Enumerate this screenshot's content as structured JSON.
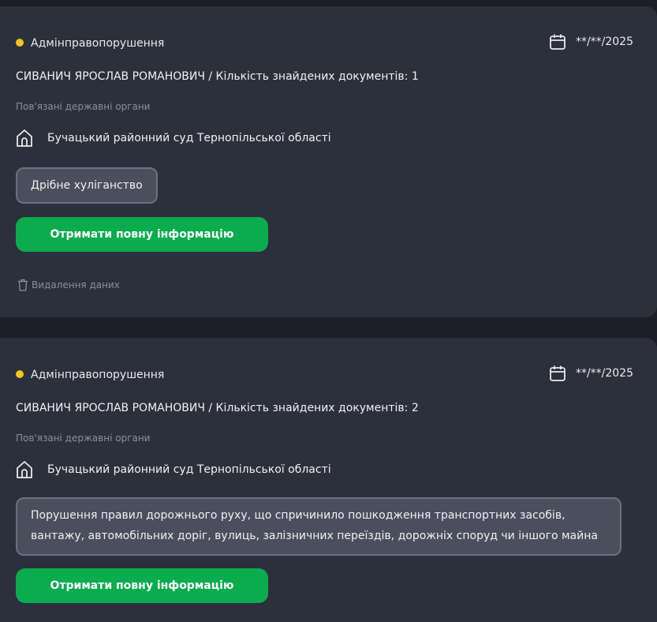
{
  "cards": [
    {
      "category": "Адмінправопорушення",
      "date": "**/**/2025",
      "title": "СИВАНИЧ ЯРОСЛАВ РОМАНОВИЧ / Кількість знайдених документів: 1",
      "related_label": "Пов'язані державні органи",
      "court": "Бучацький районний суд Тернопільської області",
      "tag": "Дрібне хуліганство",
      "button": "Отримати повну інформацію",
      "delete": "Видалення даних"
    },
    {
      "category": "Адмінправопорушення",
      "date": "**/**/2025",
      "title": "СИВАНИЧ ЯРОСЛАВ РОМАНОВИЧ / Кількість знайдених документів: 2",
      "related_label": "Пов'язані державні органи",
      "court": "Бучацький районний суд Тернопільської області",
      "tag": "Порушення правил дорожнього руху, що спричинило пошкодження транспортних засобів, вантажу, автомобільних доріг, вулиць, залізничних переїздів, дорожніх споруд чи іншого майна",
      "button": "Отримати повну інформацію"
    }
  ],
  "icons": {
    "status_dot": "status-dot",
    "date": "calendar-icon",
    "court": "building-icon",
    "delete": "trash-icon"
  },
  "colors": {
    "card_bg": "#2c2f3c",
    "page_bg": "#1c1f27",
    "accent_green": "#0bac4e",
    "status_yellow": "#f5c518",
    "tag_bg": "#4b4e5c"
  }
}
